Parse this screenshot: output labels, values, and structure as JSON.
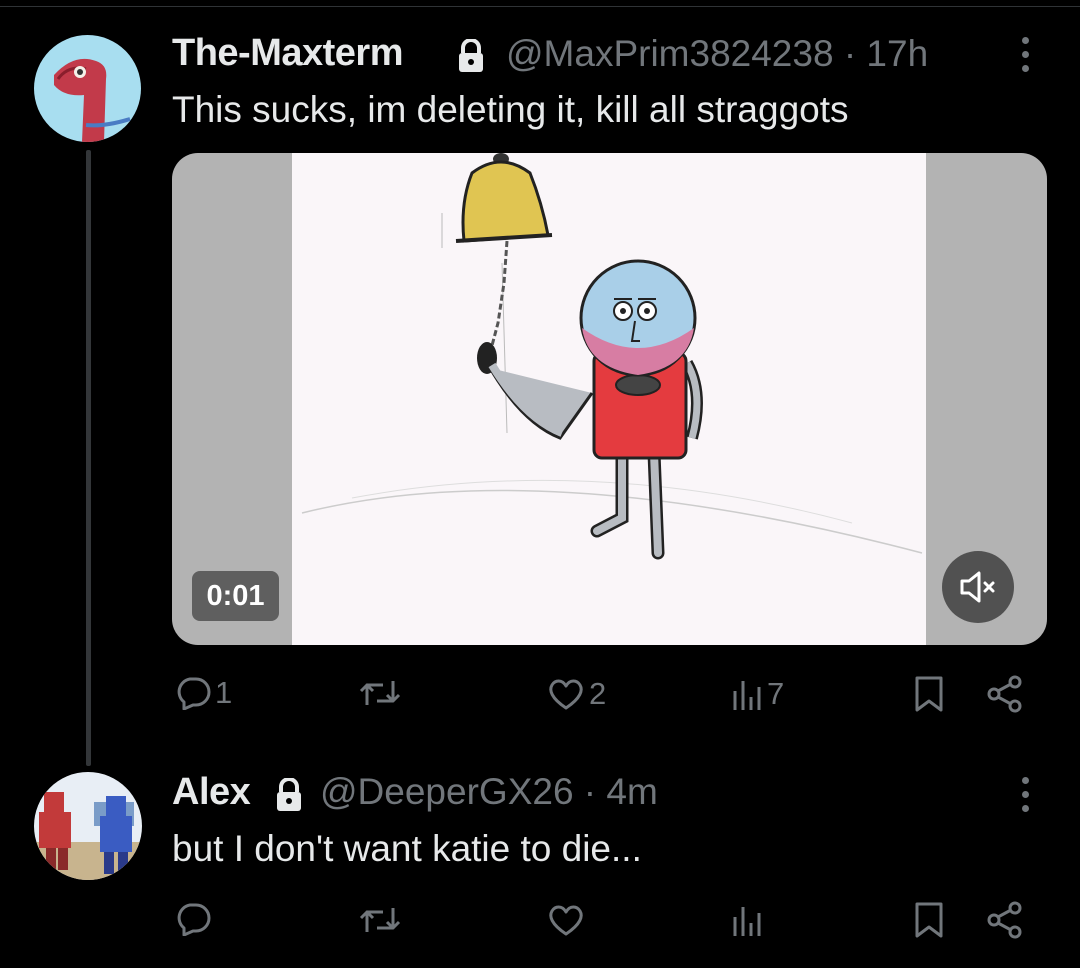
{
  "tweets": [
    {
      "author": "The-Maxterm",
      "handle_time": "@MaxPrim3824238 · 17h",
      "text": "This sucks, im deleting it, kill all straggots",
      "media": {
        "timestamp": "0:01",
        "muted": true
      },
      "actions": {
        "replies": "1",
        "reposts": "",
        "likes": "2",
        "views": "7"
      }
    },
    {
      "author": "Alex",
      "handle_time": "@DeeperGX26 · 4m",
      "text": "but I don't want katie to die...",
      "actions": {
        "replies": "",
        "reposts": "",
        "likes": "",
        "views": ""
      }
    }
  ],
  "icons": {
    "reply": "reply-icon",
    "repost": "repost-icon",
    "like": "heart-icon",
    "views": "views-icon",
    "bookmark": "bookmark-icon",
    "share": "share-icon",
    "lock": "lock-icon",
    "more": "more-icon",
    "mute": "mute-icon"
  },
  "colors": {
    "background": "#000000",
    "text": "#e7e9ea",
    "secondary": "#71767b"
  }
}
